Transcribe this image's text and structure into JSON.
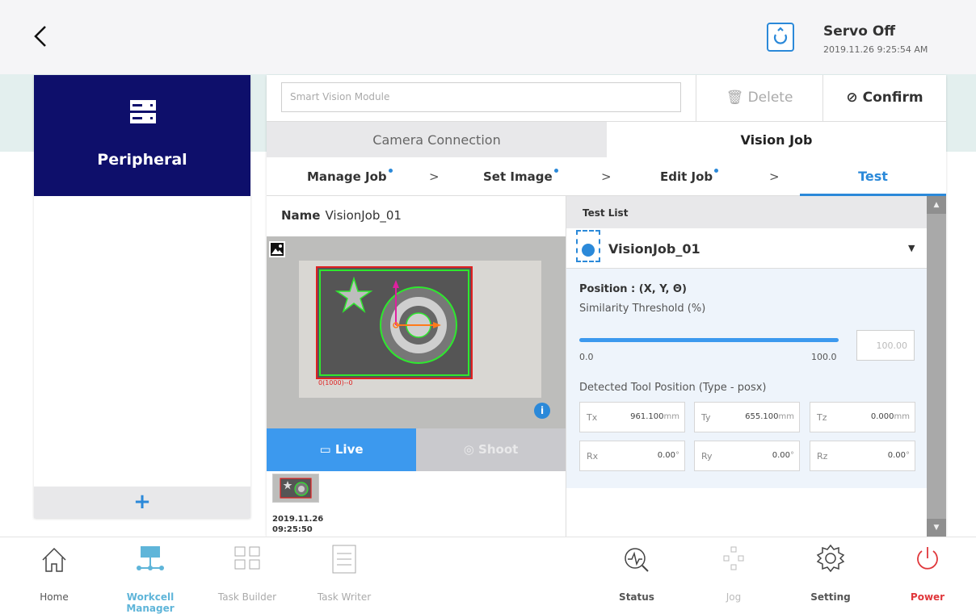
{
  "header": {
    "back_icon": "chevron-left-icon",
    "servo_status": "Servo Off",
    "datetime": "2019.11.26 9:25:54 AM"
  },
  "left_panel": {
    "title": "Peripheral",
    "add_label": "+"
  },
  "toolbar": {
    "module_placeholder": "Smart Vision Module",
    "delete_label": "Delete",
    "confirm_label": "Confirm"
  },
  "tabs": {
    "camera_connection": "Camera Connection",
    "vision_job": "Vision Job"
  },
  "steps": [
    "Manage Job",
    "Set Image",
    "Edit Job",
    "Test"
  ],
  "job": {
    "name_label": "Name",
    "name_value": "VisionJob_01",
    "overlay_text": "0(1000)--0",
    "live_label": "Live",
    "shoot_label": "Shoot",
    "thumb_date": "2019.11.26",
    "thumb_time": "09:25:50"
  },
  "test": {
    "list_label": "Test List",
    "selected_job": "VisionJob_01",
    "position_title": "Position : (X, Y, Θ)",
    "similarity_label": "Similarity Threshold (%)",
    "slider_min": "0.0",
    "slider_max": "100.0",
    "slider_fraction": 1.0,
    "similarity_value": "100.00",
    "detected_label": "Detected Tool Position (Type - posx)",
    "values": {
      "Tx": {
        "label": "Tx",
        "value": "961.100",
        "unit": "mm"
      },
      "Ty": {
        "label": "Ty",
        "value": "655.100",
        "unit": "mm"
      },
      "Tz": {
        "label": "Tz",
        "value": "0.000",
        "unit": "mm"
      },
      "Rx": {
        "label": "Rx",
        "value": "0.00",
        "unit": "°"
      },
      "Ry": {
        "label": "Ry",
        "value": "0.00",
        "unit": "°"
      },
      "Rz": {
        "label": "Rz",
        "value": "0.00",
        "unit": "°"
      }
    }
  },
  "nav": {
    "home": "Home",
    "workcell": "Workcell Manager",
    "task_builder": "Task Builder",
    "task_writer": "Task Writer",
    "status": "Status",
    "jog": "Jog",
    "setting": "Setting",
    "power": "Power"
  },
  "colors": {
    "accent": "#2b89d9",
    "peripheral_bg": "#0e0f6b",
    "live_button": "#3c99ee",
    "power": "#e0373b",
    "workcell_active": "#5fb5d9"
  }
}
